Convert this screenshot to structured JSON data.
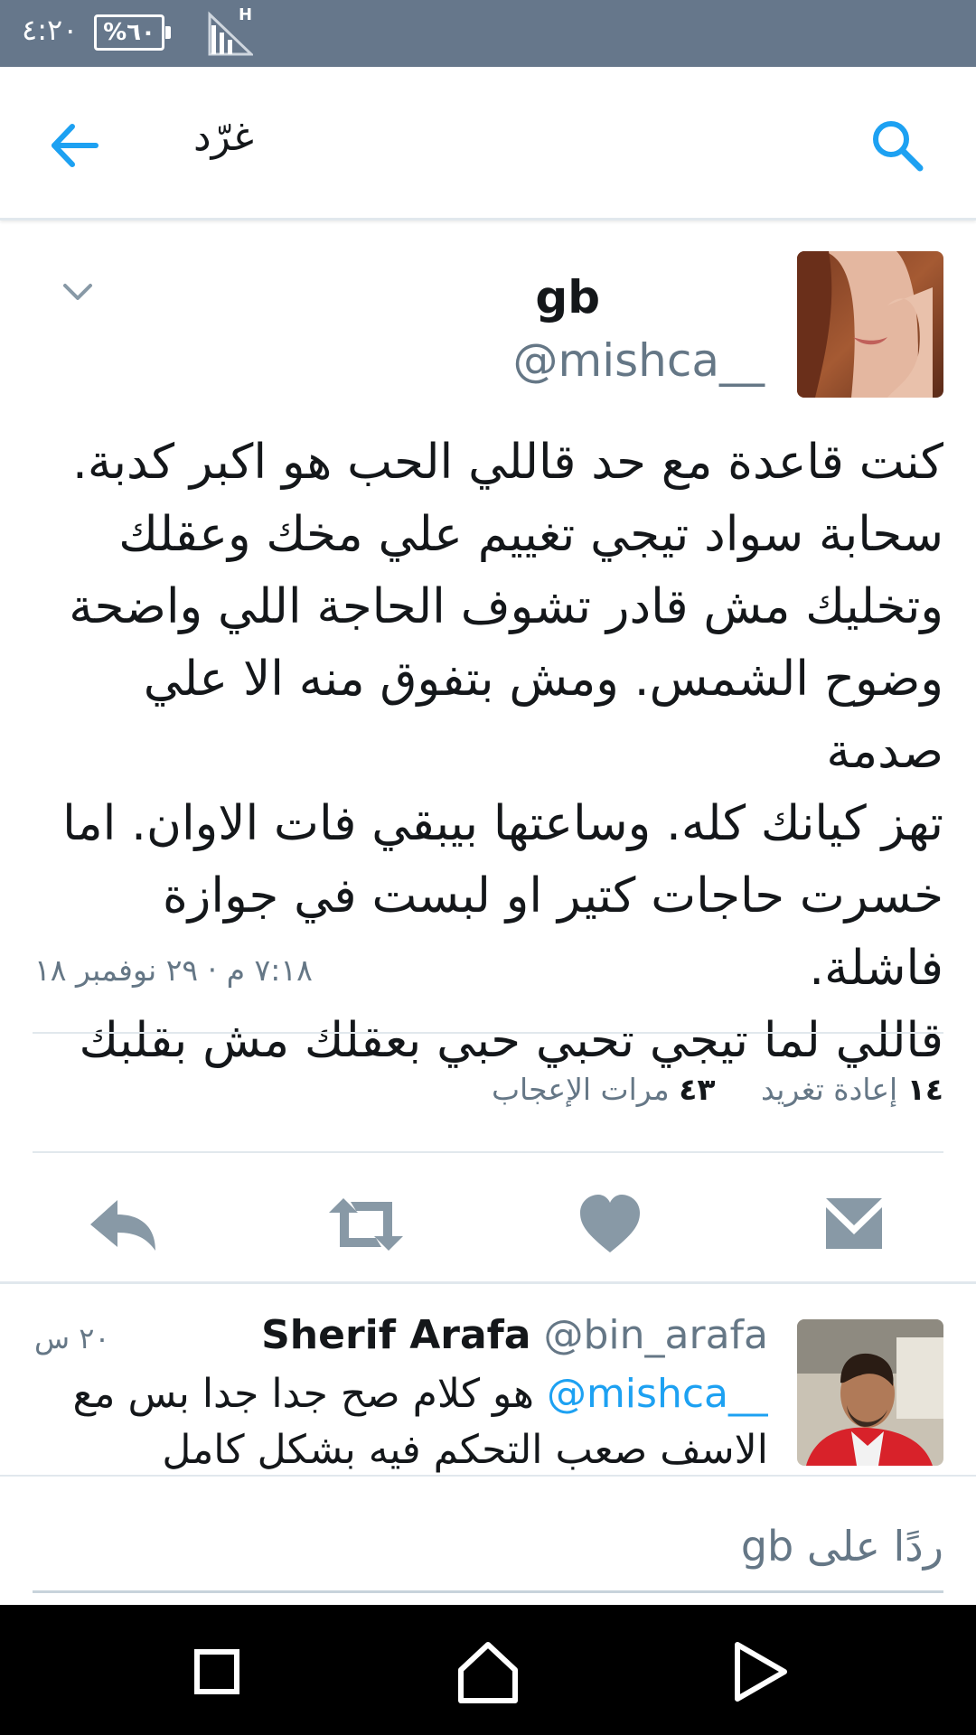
{
  "status_bar": {
    "time": "٤:٢٠",
    "battery_text": "%٦٠",
    "battery_level": 0.6,
    "network": "H",
    "background": "#66778b"
  },
  "app_bar": {
    "title": "غرّد",
    "back_icon": "arrow-left-icon",
    "search_icon": "search-icon",
    "accent": "#1da1f2"
  },
  "tweet": {
    "author_name": "gb",
    "author_handle": "@mishca__",
    "text_lines": [
      "كنت قاعدة مع حد قاللي الحب هو اكبر كدبة.",
      "سحابة سواد تيجي تغييم علي مخك وعقلك",
      "وتخليك مش قادر تشوف الحاجة اللي واضحة",
      "وضوح الشمس. ومش بتفوق منه الا علي صدمة",
      "تهز كيانك كله. وساعتها بيبقي فات الاوان. اما",
      "خسرت حاجات كتير او لبست في جوازة فاشلة.",
      "قاللي لما تيجي تحبي حبي بعقلك مش بقلبك"
    ],
    "timestamp": "٧:١٨ م · ٢٩ نوفمبر ١٨",
    "retweets_count": "١٤",
    "retweets_label": "إعادة تغريد",
    "likes_count": "٤٣",
    "likes_label": "مرات الإعجاب",
    "actions": [
      "reply-icon",
      "retweet-icon",
      "heart-icon",
      "message-icon"
    ]
  },
  "reply": {
    "name": "Sherif Arafa",
    "handle": "@bin_arafa",
    "time": "٢٠ س",
    "mention": "@mishca__",
    "text_after_mention": " هو كلام صح جدا جدا بس مع",
    "text_line2": "الاسف صعب التحكم فيه بشكل كامل"
  },
  "compose": {
    "placeholder": "ردًا على gb"
  },
  "nav_bar": {
    "buttons": [
      "recent-apps-icon",
      "home-icon",
      "back-icon"
    ]
  }
}
